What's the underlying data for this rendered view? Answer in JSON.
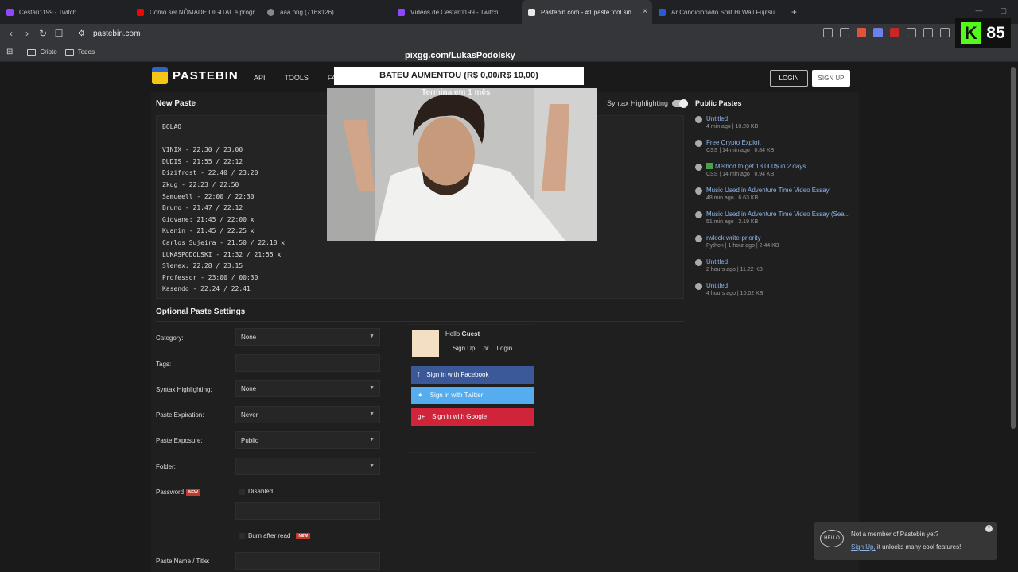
{
  "browser": {
    "tabs": [
      {
        "title": "Cestari1199 - Twitch",
        "color": "#9146ff"
      },
      {
        "title": "Como ser NÔMADE DIGITAL e progr",
        "color": "#ff0000"
      },
      {
        "title": "aaa.png (716×126)",
        "color": "#888888"
      },
      {
        "title": "Vídeos de Cestari1199 - Twitch",
        "color": "#9146ff"
      },
      {
        "title": "Pastebin.com - #1 paste tool sin",
        "color": "#e8e8e8",
        "active": true
      },
      {
        "title": "Ar Condicionado Split Hi Wall Fujitsu",
        "color": "#2a5bd7"
      }
    ],
    "close_tab": "×",
    "new_tab": "+",
    "url": "pastebin.com",
    "bookmarks": [
      "Cripto",
      "Todos"
    ]
  },
  "stream": {
    "kick_logo": "K",
    "viewer_count": "85",
    "pix_url": "pixgg.com/LukasPodolsky",
    "goal_text": "BATEU AUMENTOU (R$ 0,00/R$ 10,00)",
    "goal_sub": "Termina em 1 mês"
  },
  "header": {
    "logo": "PASTEBIN",
    "nav": [
      "API",
      "TOOLS",
      "FAQ"
    ],
    "login": "LOGIN",
    "signup": "SIGN UP"
  },
  "new_paste": {
    "title": "New Paste",
    "syntax_label": "Syntax Highlighting",
    "content": "BOLAO\n\nVINIX - 22:30 / 23:00\nDUDIS - 21:55 / 22:12\nDizifrost - 22:40 / 23:20\nZkug - 22:23 / 22:50\nSamueell - 22:00 / 22:30\nBruno - 21:47 / 22:12\nGiovane: 21:45 / 22:00 x\nKuanin - 21:45 / 22:25 x\nCarlos Sujeira - 21:50 / 22:18 x\nLUKASPODOLSKI - 21:32 / 21:55 x\nSlenex: 22:28 / 23:15\nProfessor - 23:00 / 00:30\nKasendo - 22:24 / 22:41"
  },
  "public_pastes": {
    "title": "Public Pastes",
    "items": [
      {
        "title": "Untitled",
        "meta": "4 min ago | 10.28 KB"
      },
      {
        "title": "Free Crypto Exploit",
        "meta": "CSS | 14 min ago | 0.84 KB"
      },
      {
        "title": "Method to get 13.000$ in 2 days",
        "meta": "CSS | 14 min ago | 0.94 KB"
      },
      {
        "title": "Music Used in Adventure Time Video Essay",
        "meta": "48 min ago | 6.63 KB"
      },
      {
        "title": "Music Used in Adventure Time Video Essay (Sea...",
        "meta": "51 min ago | 2.19 KB"
      },
      {
        "title": "rwlock write-priority",
        "meta": "Python | 1 hour ago | 2.44 KB"
      },
      {
        "title": "Untitled",
        "meta": "2 hours ago | 11.22 KB"
      },
      {
        "title": "Untitled",
        "meta": "4 hours ago | 10.02 KB"
      }
    ]
  },
  "settings": {
    "title": "Optional Paste Settings",
    "category_label": "Category:",
    "category_value": "None",
    "tags_label": "Tags:",
    "syntax_label": "Syntax Highlighting:",
    "syntax_value": "None",
    "expiration_label": "Paste Expiration:",
    "expiration_value": "Never",
    "exposure_label": "Paste Exposure:",
    "exposure_value": "Public",
    "folder_label": "Folder:",
    "password_label": "Password",
    "password_disabled": "Disabled",
    "burn_label": "Burn after read",
    "new_badge": "NEW",
    "name_label": "Paste Name / Title:"
  },
  "guest": {
    "hello": "Hello",
    "name": "Guest",
    "signup": "Sign Up",
    "or": "or",
    "login": "Login",
    "facebook": "Sign in with Facebook",
    "twitter": "Sign in with Twitter",
    "google": "Sign in with Google"
  },
  "toast": {
    "bubble": "HELLO",
    "line1": "Not a member of Pastebin yet?",
    "signup": "Sign Up,",
    "line2": " it unlocks many cool features!"
  }
}
